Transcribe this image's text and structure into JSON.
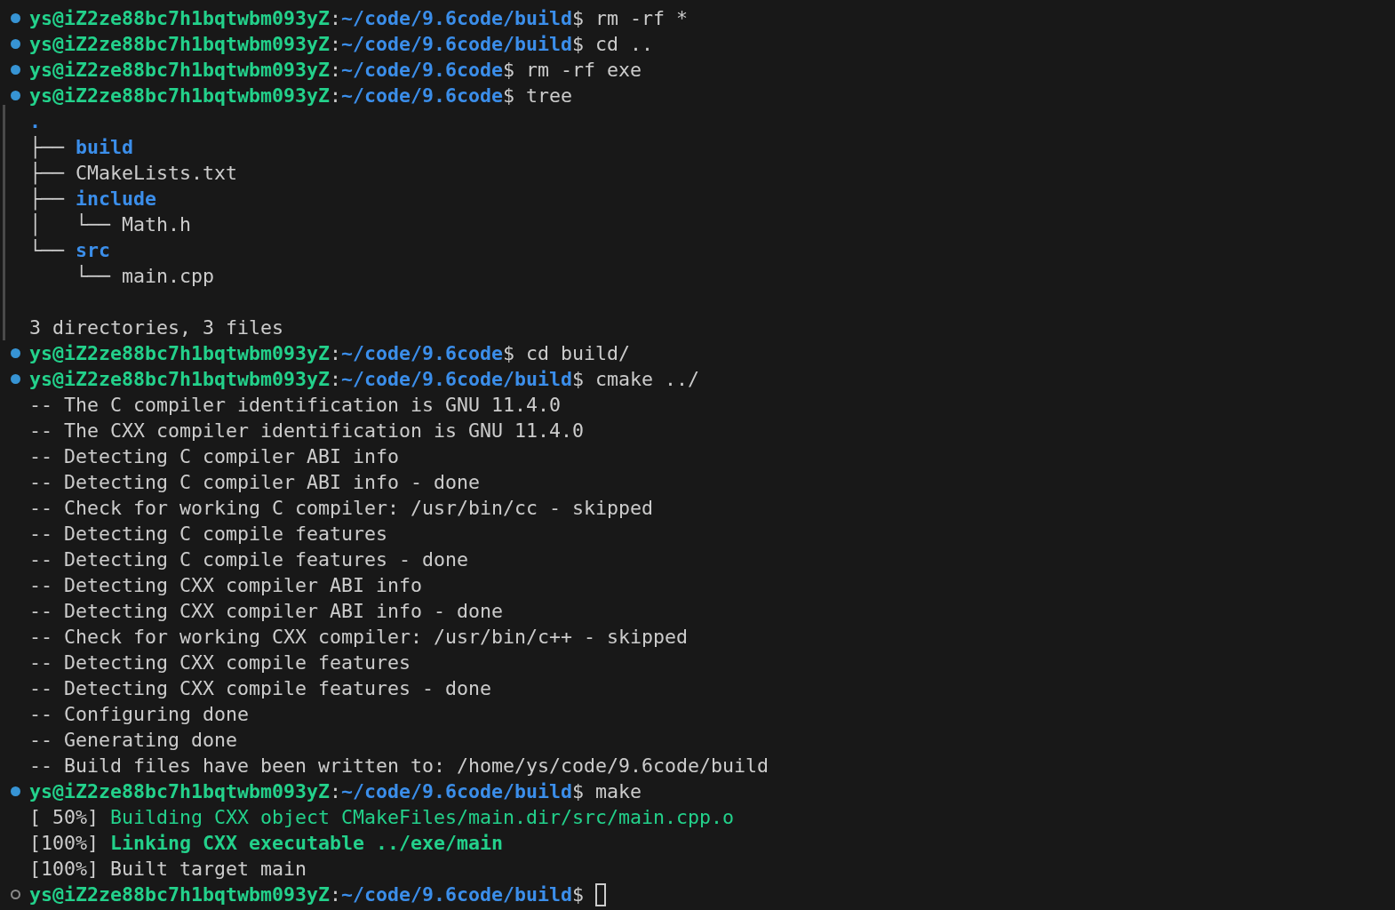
{
  "terminal": {
    "blocks": [
      {
        "done": true,
        "prompt": [
          {
            "text": "ys@iZ2ze88bc7h1bqtwbm093yZ",
            "kind": "user"
          },
          {
            "text": ":",
            "kind": "plain"
          },
          {
            "text": "~/code/9.6code/build",
            "kind": "path"
          },
          {
            "text": "$ rm -rf *",
            "kind": "plain"
          }
        ]
      },
      {
        "done": true,
        "prompt": [
          {
            "text": "ys@iZ2ze88bc7h1bqtwbm093yZ",
            "kind": "user"
          },
          {
            "text": ":",
            "kind": "plain"
          },
          {
            "text": "~/code/9.6code/build",
            "kind": "path"
          },
          {
            "text": "$ cd ..",
            "kind": "plain"
          }
        ]
      },
      {
        "done": true,
        "prompt": [
          {
            "text": "ys@iZ2ze88bc7h1bqtwbm093yZ",
            "kind": "user"
          },
          {
            "text": ":",
            "kind": "plain"
          },
          {
            "text": "~/code/9.6code",
            "kind": "path"
          },
          {
            "text": "$ rm -rf exe",
            "kind": "plain"
          }
        ]
      },
      {
        "done": true,
        "marked": true,
        "prompt": [
          {
            "text": "ys@iZ2ze88bc7h1bqtwbm093yZ",
            "kind": "user"
          },
          {
            "text": ":",
            "kind": "plain"
          },
          {
            "text": "~/code/9.6code",
            "kind": "path"
          },
          {
            "text": "$ tree",
            "kind": "plain"
          }
        ],
        "output": [
          {
            "segments": [
              {
                "text": ".",
                "kind": "dir"
              }
            ]
          },
          {
            "segments": [
              {
                "text": "├── ",
                "kind": "plain"
              },
              {
                "text": "build",
                "kind": "dir"
              }
            ]
          },
          {
            "segments": [
              {
                "text": "├── CMakeLists.txt",
                "kind": "plain"
              }
            ]
          },
          {
            "segments": [
              {
                "text": "├── ",
                "kind": "plain"
              },
              {
                "text": "include",
                "kind": "dir"
              }
            ]
          },
          {
            "segments": [
              {
                "text": "│   └── Math.h",
                "kind": "plain"
              }
            ]
          },
          {
            "segments": [
              {
                "text": "└── ",
                "kind": "plain"
              },
              {
                "text": "src",
                "kind": "dir"
              }
            ]
          },
          {
            "segments": [
              {
                "text": "    └── main.cpp",
                "kind": "plain"
              }
            ]
          },
          {
            "space_before": true,
            "segments": [
              {
                "text": "3 directories, 3 files",
                "kind": "plain"
              }
            ]
          }
        ]
      },
      {
        "done": true,
        "prompt": [
          {
            "text": "ys@iZ2ze88bc7h1bqtwbm093yZ",
            "kind": "user"
          },
          {
            "text": ":",
            "kind": "plain"
          },
          {
            "text": "~/code/9.6code",
            "kind": "path"
          },
          {
            "text": "$ cd build/",
            "kind": "plain"
          }
        ]
      },
      {
        "done": true,
        "prompt": [
          {
            "text": "ys@iZ2ze88bc7h1bqtwbm093yZ",
            "kind": "user"
          },
          {
            "text": ":",
            "kind": "plain"
          },
          {
            "text": "~/code/9.6code/build",
            "kind": "path"
          },
          {
            "text": "$ cmake ../",
            "kind": "plain"
          }
        ],
        "output": [
          {
            "segments": [
              {
                "text": "-- The C compiler identification is GNU 11.4.0",
                "kind": "plain"
              }
            ]
          },
          {
            "segments": [
              {
                "text": "-- The CXX compiler identification is GNU 11.4.0",
                "kind": "plain"
              }
            ]
          },
          {
            "segments": [
              {
                "text": "-- Detecting C compiler ABI info",
                "kind": "plain"
              }
            ]
          },
          {
            "segments": [
              {
                "text": "-- Detecting C compiler ABI info - done",
                "kind": "plain"
              }
            ]
          },
          {
            "segments": [
              {
                "text": "-- Check for working C compiler: /usr/bin/cc - skipped",
                "kind": "plain"
              }
            ]
          },
          {
            "segments": [
              {
                "text": "-- Detecting C compile features",
                "kind": "plain"
              }
            ]
          },
          {
            "segments": [
              {
                "text": "-- Detecting C compile features - done",
                "kind": "plain"
              }
            ]
          },
          {
            "segments": [
              {
                "text": "-- Detecting CXX compiler ABI info",
                "kind": "plain"
              }
            ]
          },
          {
            "segments": [
              {
                "text": "-- Detecting CXX compiler ABI info - done",
                "kind": "plain"
              }
            ]
          },
          {
            "segments": [
              {
                "text": "-- Check for working CXX compiler: /usr/bin/c++ - skipped",
                "kind": "plain"
              }
            ]
          },
          {
            "segments": [
              {
                "text": "-- Detecting CXX compile features",
                "kind": "plain"
              }
            ]
          },
          {
            "segments": [
              {
                "text": "-- Detecting CXX compile features - done",
                "kind": "plain"
              }
            ]
          },
          {
            "segments": [
              {
                "text": "-- Configuring done",
                "kind": "plain"
              }
            ]
          },
          {
            "segments": [
              {
                "text": "-- Generating done",
                "kind": "plain"
              }
            ]
          },
          {
            "segments": [
              {
                "text": "-- Build files have been written to: /home/ys/code/9.6code/build",
                "kind": "plain"
              }
            ]
          }
        ]
      },
      {
        "done": true,
        "prompt": [
          {
            "text": "ys@iZ2ze88bc7h1bqtwbm093yZ",
            "kind": "user"
          },
          {
            "text": ":",
            "kind": "plain"
          },
          {
            "text": "~/code/9.6code/build",
            "kind": "path"
          },
          {
            "text": "$ make",
            "kind": "plain"
          }
        ],
        "output": [
          {
            "segments": [
              {
                "text": "[ 50%] ",
                "kind": "plain"
              },
              {
                "text": "Building CXX object CMakeFiles/main.dir/src/main.cpp.o",
                "kind": "ok"
              }
            ]
          },
          {
            "segments": [
              {
                "text": "[100%] ",
                "kind": "plain"
              },
              {
                "text": "Linking CXX executable ../exe/main",
                "kind": "ok_bold"
              }
            ]
          },
          {
            "segments": [
              {
                "text": "[100%] Built target main",
                "kind": "plain"
              }
            ]
          }
        ]
      },
      {
        "done": false,
        "cursor": true,
        "prompt": [
          {
            "text": "ys@iZ2ze88bc7h1bqtwbm093yZ",
            "kind": "user"
          },
          {
            "text": ":",
            "kind": "plain"
          },
          {
            "text": "~/code/9.6code/build",
            "kind": "path"
          },
          {
            "text": "$ ",
            "kind": "plain"
          }
        ]
      }
    ]
  }
}
